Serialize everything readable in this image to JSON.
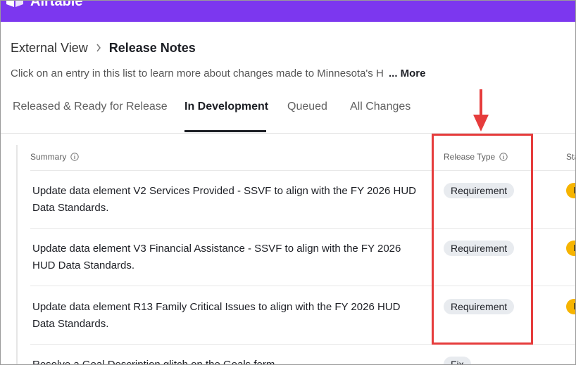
{
  "app": {
    "logo_text": "Airtable",
    "accent_color": "#7c37ef"
  },
  "breadcrumb": {
    "parent": "External View",
    "separator_icon": "chevron-right-icon",
    "current": "Release Notes"
  },
  "description": {
    "text": "Click on an entry in this list to learn more about changes made to Minnesota's H",
    "more_label": "... More"
  },
  "tabs": [
    {
      "label": "Released & Ready for Release",
      "active": false
    },
    {
      "label": "In Development",
      "active": true
    },
    {
      "label": "Queued",
      "active": false
    },
    {
      "label": "All Changes",
      "active": false
    }
  ],
  "table": {
    "columns": [
      {
        "label": "Summary",
        "icon": "info-icon"
      },
      {
        "label": "Release Type",
        "icon": "info-icon"
      },
      {
        "label": "Sta"
      }
    ],
    "rows": [
      {
        "summary": "Update data element V2 Services Provided - SSVF to align with the FY 2026 HUD Data Standards.",
        "release_type": "Requirement",
        "status": "I"
      },
      {
        "summary": "Update data element V3 Financial Assistance - SSVF to align with the FY 2026 HUD Data Standards.",
        "release_type": "Requirement",
        "status": "I"
      },
      {
        "summary": "Update data element R13 Family Critical Issues to align with the FY 2026 HUD Data Standards.",
        "release_type": "Requirement",
        "status": "I"
      },
      {
        "summary": "Resolve a Goal Description glitch on the Goals form",
        "release_type": "Fix",
        "status": ""
      }
    ]
  },
  "annotation": {
    "color": "#e63c3c"
  }
}
